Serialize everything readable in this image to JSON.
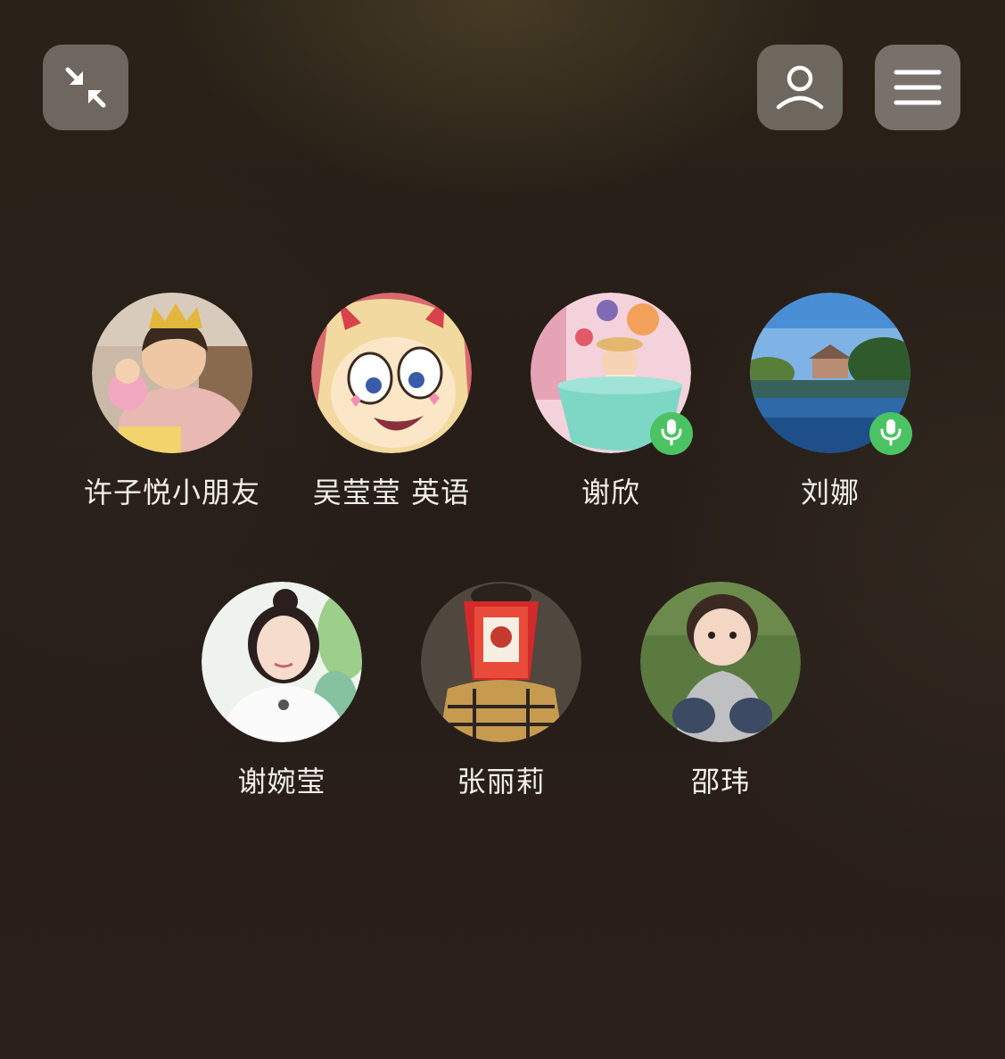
{
  "toolbar": {
    "collapse_icon": "collapse-arrows-icon",
    "members_icon": "person-icon",
    "menu_icon": "hamburger-menu-icon"
  },
  "colors": {
    "mic_active": "#4cc363",
    "button_bg": "#6f675f",
    "name_text": "#f2eeea"
  },
  "participants": [
    {
      "name": "许子悦小朋友",
      "avatar": "toddler-with-crown-photo",
      "speaking": false
    },
    {
      "name": "吴莹莹 英语",
      "avatar": "cartoon-girl-with-horns",
      "speaking": false
    },
    {
      "name": "谢欣",
      "avatar": "baby-in-teacup-photo",
      "speaking": true
    },
    {
      "name": "刘娜",
      "avatar": "lake-landscape-photo",
      "speaking": true
    },
    {
      "name": "谢婉莹",
      "avatar": "woman-portrait-photo",
      "speaking": false
    },
    {
      "name": "张丽莉",
      "avatar": "person-holding-kfc-bucket",
      "speaking": false
    },
    {
      "name": "邵玮",
      "avatar": "toddler-on-grass-photo",
      "speaking": false
    }
  ]
}
